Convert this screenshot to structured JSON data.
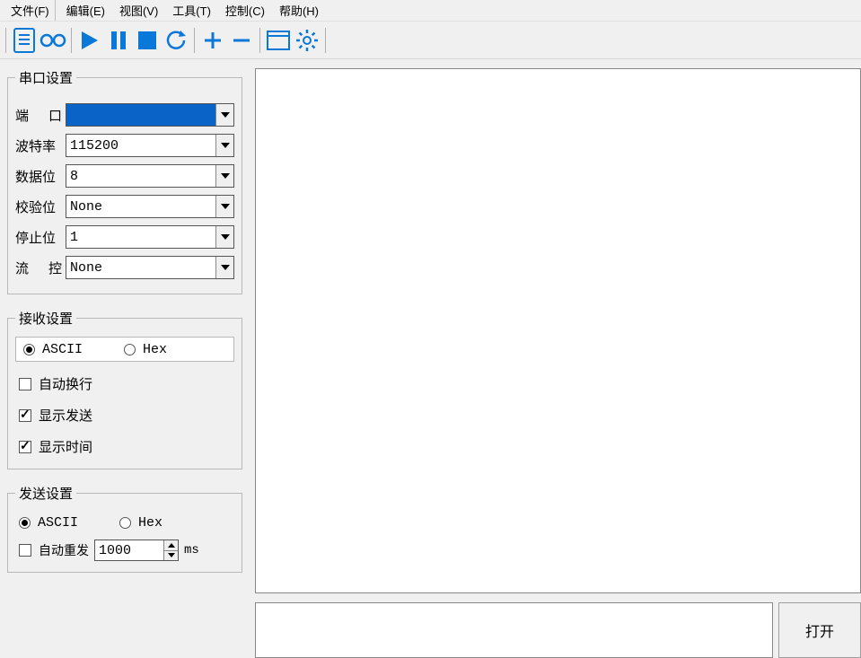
{
  "menu": {
    "file": "文件(F)",
    "edit": "编辑(E)",
    "view": "视图(V)",
    "tools": "工具(T)",
    "control": "控制(C)",
    "help": "帮助(H)"
  },
  "colors": {
    "accent": "#0a64c8"
  },
  "serial": {
    "legend": "串口设置",
    "port_label_a": "端",
    "port_label_b": "口",
    "port_value": "",
    "baud_label": "波特率",
    "baud_value": "115200",
    "data_label": "数据位",
    "data_value": "8",
    "parity_label": "校验位",
    "parity_value": "None",
    "stop_label": "停止位",
    "stop_value": "1",
    "flow_label_a": "流",
    "flow_label_b": "控",
    "flow_value": "None"
  },
  "recv": {
    "legend": "接收设置",
    "ascii": "ASCII",
    "hex": "Hex",
    "wrap": "自动换行",
    "show_send": "显示发送",
    "show_time": "显示时间"
  },
  "sendcfg": {
    "legend": "发送设置",
    "ascii": "ASCII",
    "hex": "Hex",
    "auto": "自动重发",
    "interval": "1000",
    "unit": "ms"
  },
  "footer": {
    "open": "打开"
  }
}
